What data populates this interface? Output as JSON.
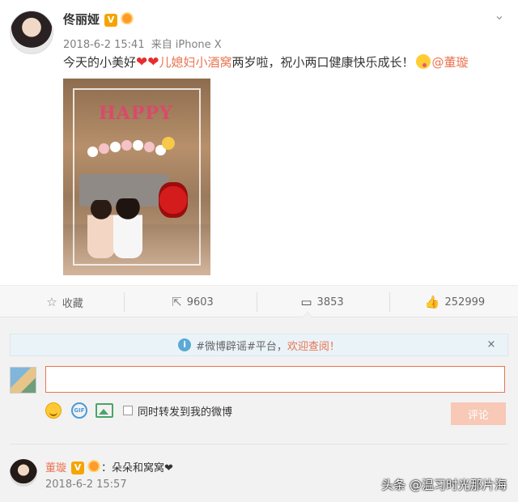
{
  "post": {
    "author": "佟丽娅",
    "badge": "V",
    "time": "2018-6-2 15:41",
    "source_prefix": "来自",
    "source": "iPhone X",
    "content": {
      "part1": "今天的小美好",
      "heart": "❤❤",
      "highlight": "儿媳妇小酒窝",
      "part2": "两岁啦，祝小两口健康快乐成长！",
      "mention": "@董璇"
    },
    "photo_text": "HAPPY"
  },
  "actions": {
    "favorite": {
      "label": "收藏",
      "icon": "star-icon"
    },
    "repost": {
      "count": "9603",
      "icon": "share-icon"
    },
    "comment": {
      "count": "3853",
      "icon": "comment-icon"
    },
    "like": {
      "count": "252999",
      "icon": "thumbs-up-icon"
    }
  },
  "notice": {
    "text": "#微博辟谣#平台，",
    "link": "欢迎查阅！",
    "close": "×"
  },
  "compose": {
    "placeholder": "",
    "gif_label": "GIF",
    "repost_label": "同时转发到我的微博",
    "submit_label": "评论"
  },
  "comments": [
    {
      "author": "董璇",
      "badge": "V",
      "text": "：朵朵和窝窝❤",
      "time": "2018-6-2 15:57"
    }
  ],
  "watermark": "头条 @温习时光那片海",
  "colors": {
    "accent": "#eb7350",
    "verified": "#f5a400",
    "input_border": "#eb7350",
    "button_disabled": "#f7c9b6"
  }
}
